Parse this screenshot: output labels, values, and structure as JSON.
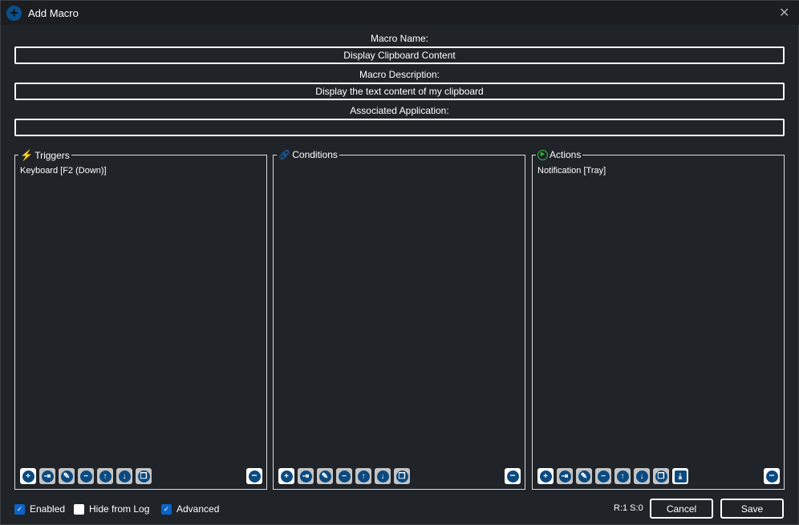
{
  "window": {
    "title": "Add Macro",
    "icon": "plus-circle-icon",
    "close_icon": "close-icon"
  },
  "form": {
    "name_label": "Macro Name:",
    "name_value": "Display Clipboard Content",
    "description_label": "Macro Description:",
    "description_value": "Display the text content of my clipboard",
    "app_label": "Associated Application:",
    "app_value": ""
  },
  "panels": {
    "triggers": {
      "title": "Triggers",
      "icon": "lightning-icon",
      "items": [
        "Keyboard [F2 (Down)]"
      ]
    },
    "conditions": {
      "title": "Conditions",
      "icon": "link-icon",
      "items": []
    },
    "actions": {
      "title": "Actions",
      "icon": "play-icon",
      "items": [
        "Notification [Tray]"
      ]
    }
  },
  "toolbar_icons": [
    "add",
    "import",
    "edit",
    "remove",
    "move-up",
    "move-down",
    "duplicate"
  ],
  "footer": {
    "enabled": {
      "label": "Enabled",
      "checked": true
    },
    "hide_from_log": {
      "label": "Hide from Log",
      "checked": false
    },
    "advanced": {
      "label": "Advanced",
      "checked": true
    },
    "status": "R:1 S:0",
    "cancel": "Cancel",
    "save": "Save"
  },
  "colors": {
    "accent": "#0b4a80",
    "checkbox": "#0a64c8",
    "trigger_icon": "#e02020",
    "condition_icon": "#1e7fe0",
    "action_icon": "#2ec040"
  }
}
